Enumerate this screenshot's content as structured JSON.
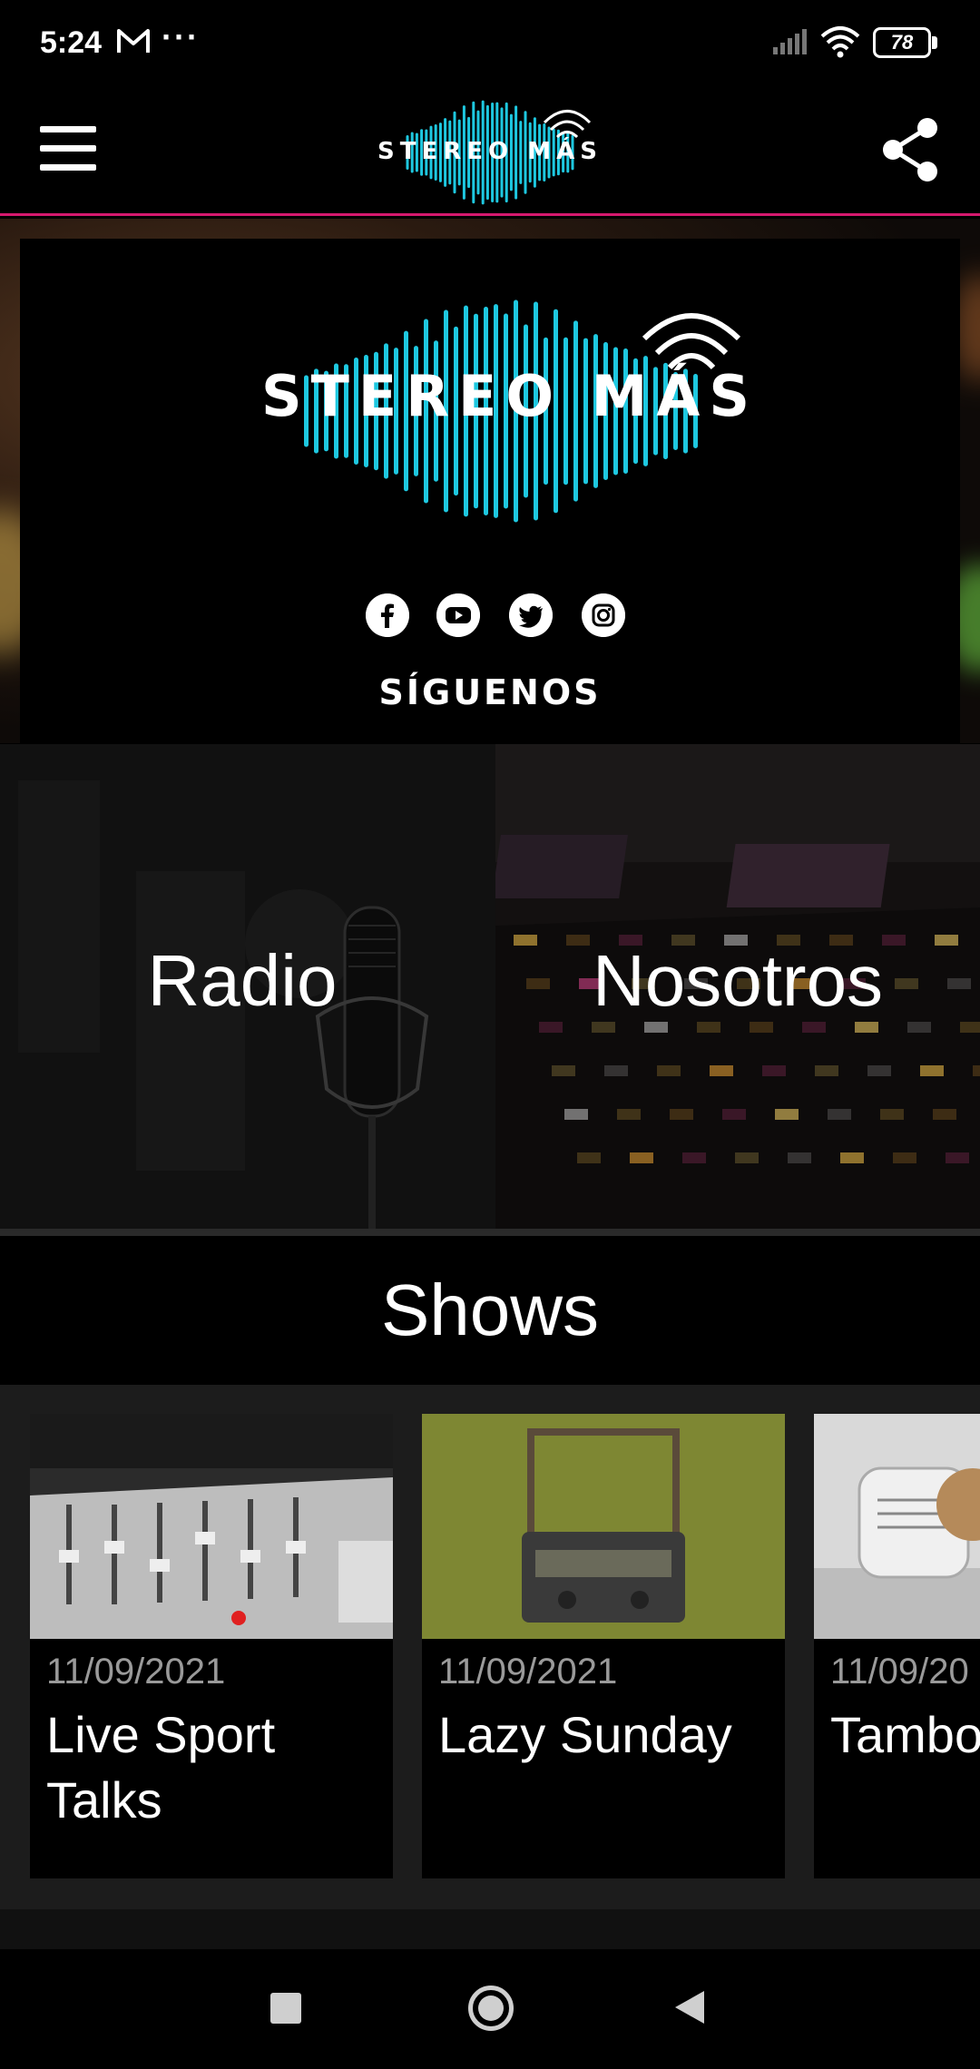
{
  "status_bar": {
    "time": "5:24",
    "notification_icons": [
      "gmail-icon",
      "more-dots-icon"
    ],
    "dots": "···",
    "battery_level": "78"
  },
  "app_bar": {
    "logo_text": "STEREO MÁS",
    "menu_icon": "hamburger-menu-icon",
    "share_icon": "share-icon",
    "accent_color": "#d6196e"
  },
  "hero": {
    "logo_text": "STEREO MÁS",
    "logo_color": "#1ec8e0",
    "social": [
      "facebook-icon",
      "youtube-icon",
      "twitter-icon",
      "instagram-icon"
    ],
    "follow_label": "SÍGUENOS"
  },
  "tiles": [
    {
      "label": "Radio"
    },
    {
      "label": "Nosotros"
    }
  ],
  "shows": {
    "title": "Shows",
    "items": [
      {
        "date": "11/09/2021",
        "title": "Live Sport Talks"
      },
      {
        "date": "11/09/2021",
        "title": "Lazy Sunday"
      },
      {
        "date": "11/09/20",
        "title": "Tambo Digest"
      }
    ]
  },
  "nav_bar": {
    "buttons": [
      "recents-button",
      "home-button",
      "back-button"
    ]
  }
}
